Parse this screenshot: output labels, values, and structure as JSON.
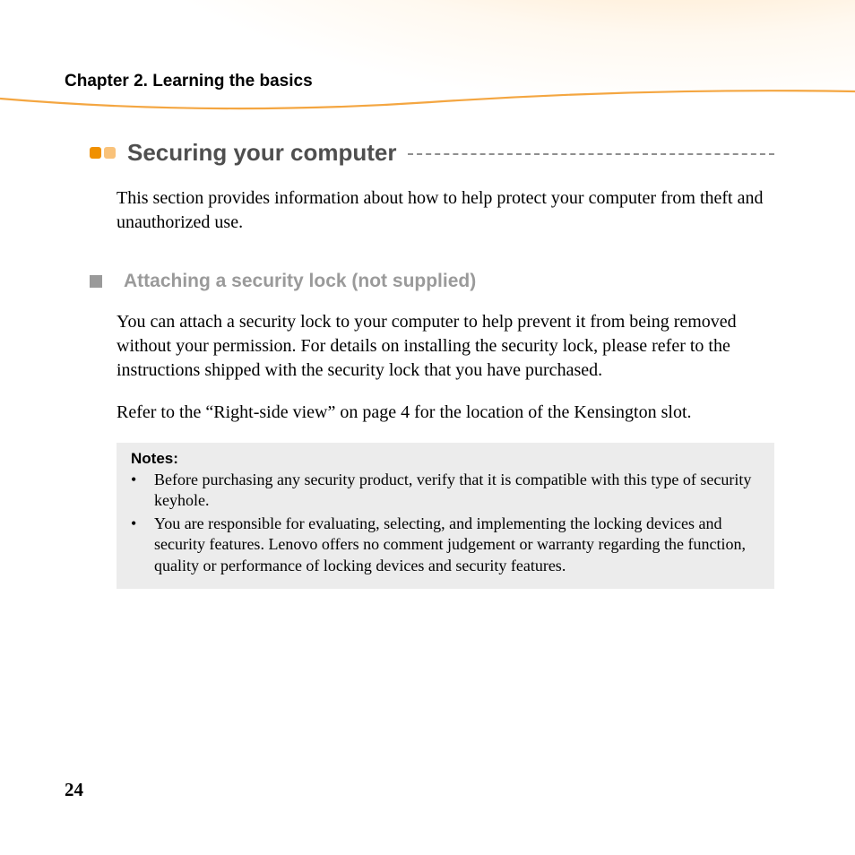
{
  "header": {
    "chapter": "Chapter 2. Learning the basics"
  },
  "section": {
    "title": "Securing your computer",
    "intro": "This section provides information about how to help protect your computer from theft and unauthorized use."
  },
  "subsection": {
    "title": "Attaching a security lock (not supplied)",
    "para1": "You can attach a security lock to your computer to help prevent it from being removed without your permission. For details on installing the security lock, please refer to the instructions shipped with the security lock that you have purchased.",
    "para2": "Refer to the “Right-side view” on page 4 for the location of the Kensington slot."
  },
  "notes": {
    "label": "Notes:",
    "items": [
      "Before purchasing any security product, verify that it is compatible with this type of security keyhole.",
      "You are responsible for evaluating, selecting, and implementing the locking devices and security features. Lenovo offers no comment judgement or warranty regarding the function, quality or performance of locking devices and security features."
    ]
  },
  "page_number": "24"
}
